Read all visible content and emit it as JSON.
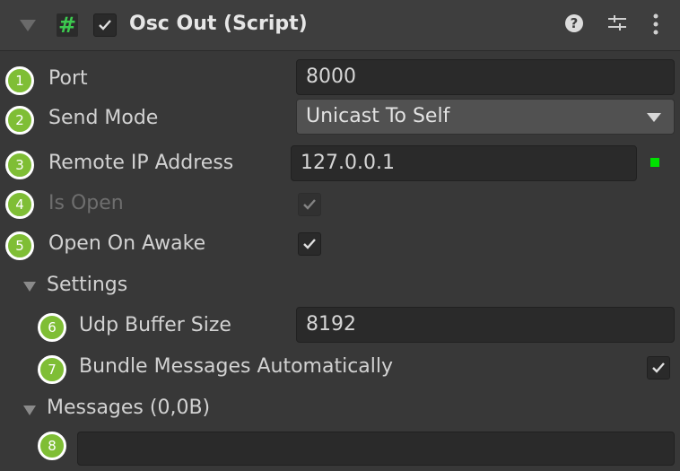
{
  "component": {
    "title": "Osc Out (Script)",
    "script_icon_glyph": "#",
    "icons": [
      "script-icon",
      "help-icon",
      "preset-icon",
      "kebab-menu-icon"
    ]
  },
  "fields": {
    "port": {
      "label": "Port",
      "value": "8000",
      "badge": "1"
    },
    "send_mode": {
      "label": "Send Mode",
      "value": "Unicast To Self",
      "badge": "2"
    },
    "remote_ip": {
      "label": "Remote IP Address",
      "value": "127.0.0.1",
      "badge": "3",
      "status_color": "#00e000"
    },
    "is_open": {
      "label": "Is Open",
      "badge": "4",
      "checked": true,
      "disabled": true
    },
    "open_on_awake": {
      "label": "Open On Awake",
      "badge": "5",
      "checked": true
    }
  },
  "settings": {
    "label": "Settings",
    "udp_buffer_size": {
      "label": "Udp Buffer Size",
      "value": "8192",
      "badge": "6"
    },
    "bundle_messages": {
      "label": "Bundle Messages Automatically",
      "badge": "7",
      "checked": true
    }
  },
  "messages": {
    "label": "Messages (0,0B)",
    "badge": "8",
    "value": ""
  },
  "colors": {
    "badge": "#7fbe35",
    "background": "#383838",
    "header": "#3e3e3e"
  }
}
